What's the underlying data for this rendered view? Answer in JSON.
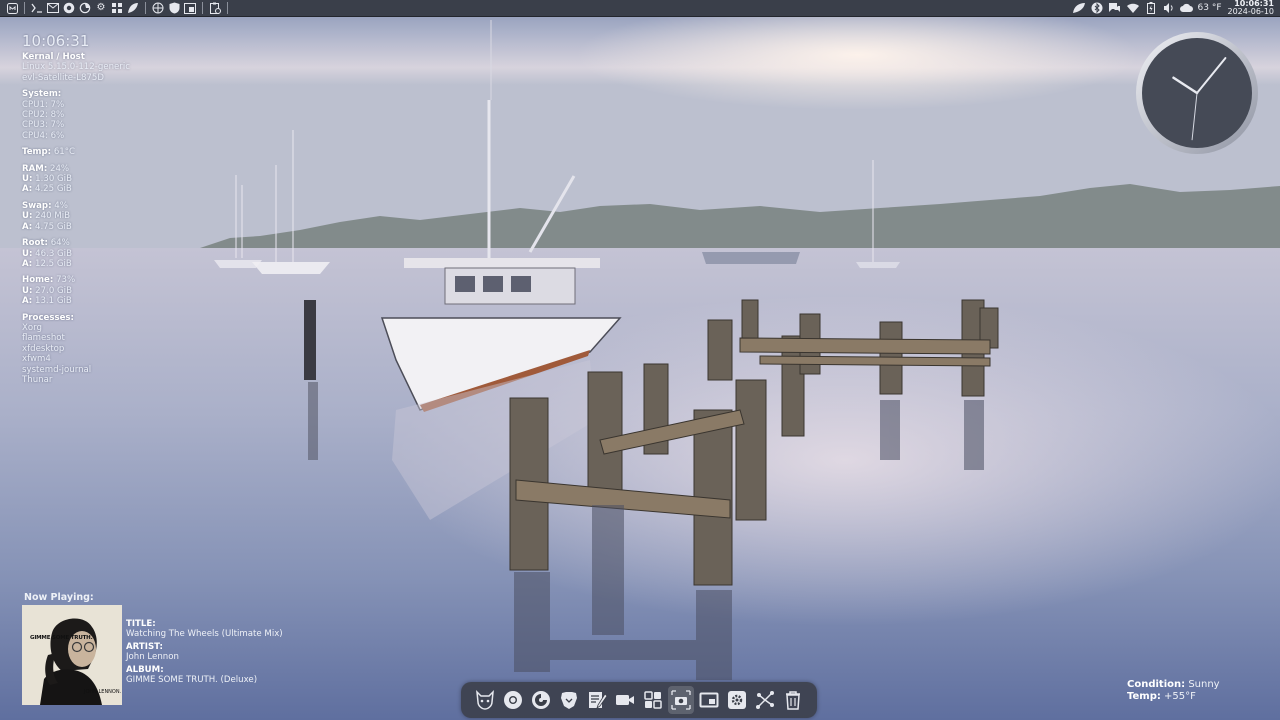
{
  "top_panel": {
    "weather_text": "63 °F",
    "clock_time": "10:06:31",
    "clock_date": "2024-06-10"
  },
  "conky": {
    "time": "10:06:31",
    "kernel_header": "Kernal / Host",
    "kernel": "Linux 5.15.0-112-generic",
    "host": "evl-Satellite-L875D",
    "system_header": "System:",
    "cpus": [
      "CPU1: 7%",
      "CPU2: 8%",
      "CPU3: 7%",
      "CPU4: 6%"
    ],
    "temp_label": "Temp:",
    "temp_value": "61°C",
    "ram_label": "RAM:",
    "ram_value": "24%",
    "ram_used_label": "U:",
    "ram_used": "1.30 GiB",
    "ram_avail_label": "A:",
    "ram_avail": "4.25 GiB",
    "swap_label": "Swap:",
    "swap_value": "4%",
    "swap_used_label": "U:",
    "swap_used": "240 MiB",
    "swap_avail_label": "A:",
    "swap_avail": "4.75 GiB",
    "root_label": "Root:",
    "root_value": "64%",
    "root_used_label": "U:",
    "root_used": "46.3 GiB",
    "root_avail_label": "A:",
    "root_avail": "12.5 GiB",
    "home_label": "Home:",
    "home_value": "73%",
    "home_used_label": "U:",
    "home_used": "27.0 GiB",
    "home_avail_label": "A:",
    "home_avail": "13.1 GiB",
    "processes_header": "Processes:",
    "processes": [
      "Xorg",
      "flameshot",
      "xfdesktop",
      "xfwm4",
      "systemd-journal",
      "Thunar"
    ]
  },
  "now_playing": {
    "header": "Now Playing:",
    "title_label": "TITLE:",
    "title": "Watching The Wheels (Ultimate Mix)",
    "artist_label": "ARTIST:",
    "artist": "John Lennon",
    "album_label": "ALBUM:",
    "album": "GIMME SOME TRUTH. (Deluxe)",
    "album_art_text": "GIMME SOME TRUTH.",
    "album_art_artist": "JOHN LENNON."
  },
  "weather": {
    "condition_label": "Condition:",
    "condition": "Sunny",
    "temp_label": "Temp:",
    "temp": "+55°F"
  },
  "analog_clock": {
    "hour": 10,
    "minute": 6,
    "second": 31
  },
  "colors": {
    "panel_bg": "#3a3f4a",
    "dock_bg": "#3a3e48",
    "text": "#eef1f7"
  }
}
